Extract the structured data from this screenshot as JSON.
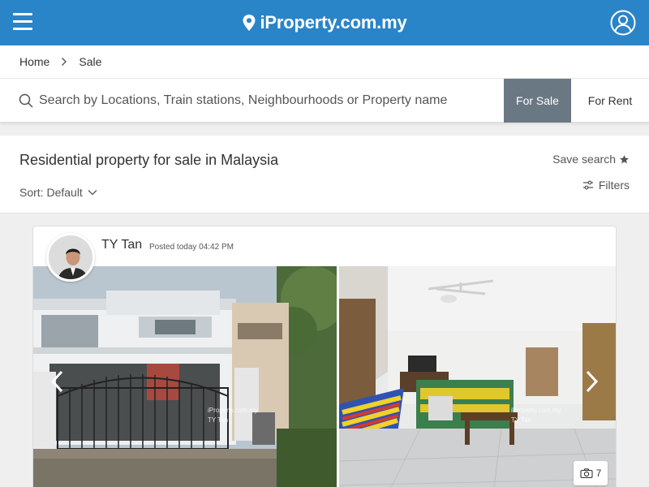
{
  "header": {
    "brand": "iProperty.com.my",
    "menu_icon": "hamburger-menu-icon",
    "profile_icon": "user-profile-icon",
    "brand_color": "#2a84c8"
  },
  "breadcrumb": {
    "items": [
      "Home",
      "Sale"
    ]
  },
  "search": {
    "placeholder": "Search by Locations, Train stations, Neighbourhoods or Property name",
    "value": "",
    "tabs": [
      {
        "label": "For Sale",
        "active": true
      },
      {
        "label": "For Rent",
        "active": false
      }
    ]
  },
  "results": {
    "title": "Residential property for sale in Malaysia",
    "sort_label": "Sort: Default",
    "save_search_label": "Save search",
    "filters_label": "Filters"
  },
  "listing": {
    "agent_name": "TY Tan",
    "posted": "Posted today 04:42 PM",
    "photo_count": "7",
    "watermark": "iProperty.com.my",
    "watermark_agent": "TY Tan"
  }
}
